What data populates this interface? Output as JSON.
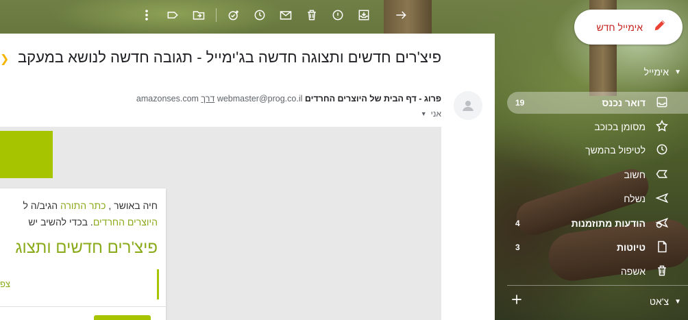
{
  "toolbar": {
    "icons": [
      "back-arrow-icon",
      "move-to-inbox-icon",
      "report-spam-icon",
      "delete-icon",
      "mark-unread-icon",
      "snooze-icon",
      "add-task-icon",
      "move-to-icon",
      "labels-icon",
      "more-options-icon"
    ]
  },
  "compose": {
    "label": "אימייל חדש"
  },
  "sidebar": {
    "mail_header": "אימייל",
    "items": [
      {
        "label": "דואר נכנס",
        "count": "19",
        "icon": "inbox-icon",
        "bold": true
      },
      {
        "label": "מסומן בכוכב",
        "count": "",
        "icon": "star-icon",
        "bold": false
      },
      {
        "label": "לטיפול בהמשך",
        "count": "",
        "icon": "clock-icon",
        "bold": false
      },
      {
        "label": "חשוב",
        "count": "",
        "icon": "important-icon",
        "bold": false
      },
      {
        "label": "נשלח",
        "count": "",
        "icon": "send-icon",
        "bold": false
      },
      {
        "label": "הודעות מתוזמנות",
        "count": "4",
        "icon": "scheduled-icon",
        "bold": true
      },
      {
        "label": "טיוטות",
        "count": "3",
        "icon": "draft-icon",
        "bold": true
      },
      {
        "label": "אשפה",
        "count": "",
        "icon": "trash-icon",
        "bold": false
      }
    ],
    "chat_header": "צ'אט"
  },
  "email": {
    "subject": "פיצ'רים חדשים ותצוגה חדשה בג'ימייל - תגובה חדשה לנושא במעקב",
    "sender_name": "פרוג - דף הבית של היוצרים החרדים",
    "sender_email": "webmaster@prog.co.il",
    "via_label": "דרך",
    "via_domain": "amazonses.com",
    "to": "אני",
    "body_line1_a": "חיה באושר ,",
    "body_line1_link": "כתר התורה",
    "body_line1_b": " הגיב/ה ל",
    "body_line2_link": "היוצרים החרדים",
    "body_line2_b": ". בכדי להשיב יש",
    "body_title": "פיצ'רים חדשים ותצוג",
    "body_snippet": "צפ"
  },
  "colors": {
    "accent": "#a7c400",
    "compose_text": "#c5221f"
  }
}
